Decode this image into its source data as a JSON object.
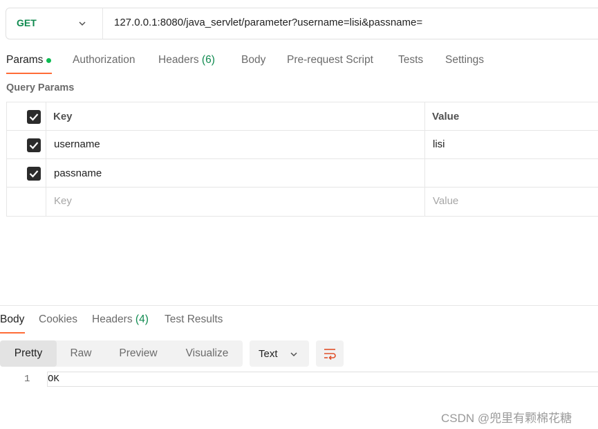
{
  "request": {
    "method": "GET",
    "url": "127.0.0.1:8080/java_servlet/parameter?username=lisi&passname="
  },
  "request_tabs": [
    {
      "label": "Params",
      "active": true
    },
    {
      "label": "Authorization"
    },
    {
      "label": "Headers",
      "count": "(6)"
    },
    {
      "label": "Body"
    },
    {
      "label": "Pre-request Script"
    },
    {
      "label": "Tests"
    },
    {
      "label": "Settings"
    }
  ],
  "params": {
    "title": "Query Params",
    "header": {
      "key": "Key",
      "value": "Value"
    },
    "rows": [
      {
        "key": "username",
        "value": "lisi",
        "checked": true
      },
      {
        "key": "passname",
        "value": "",
        "checked": true
      }
    ],
    "placeholder": {
      "key": "Key",
      "value": "Value"
    }
  },
  "response_tabs": [
    {
      "label": "Body",
      "active": true
    },
    {
      "label": "Cookies"
    },
    {
      "label": "Headers",
      "count": "(4)"
    },
    {
      "label": "Test Results"
    }
  ],
  "response_toolbar": {
    "views": [
      "Pretty",
      "Raw",
      "Preview",
      "Visualize"
    ],
    "active_view": "Pretty",
    "format": "Text"
  },
  "response_body": {
    "lines": [
      {
        "number": "1",
        "text": "OK"
      }
    ]
  },
  "watermark": "CSDN @兜里有颗棉花糖",
  "colors": {
    "method_get": "#0f8a4f",
    "accent": "#ff6c37",
    "active_dot": "#0cbb52",
    "wrap_icon": "#e0502a"
  }
}
